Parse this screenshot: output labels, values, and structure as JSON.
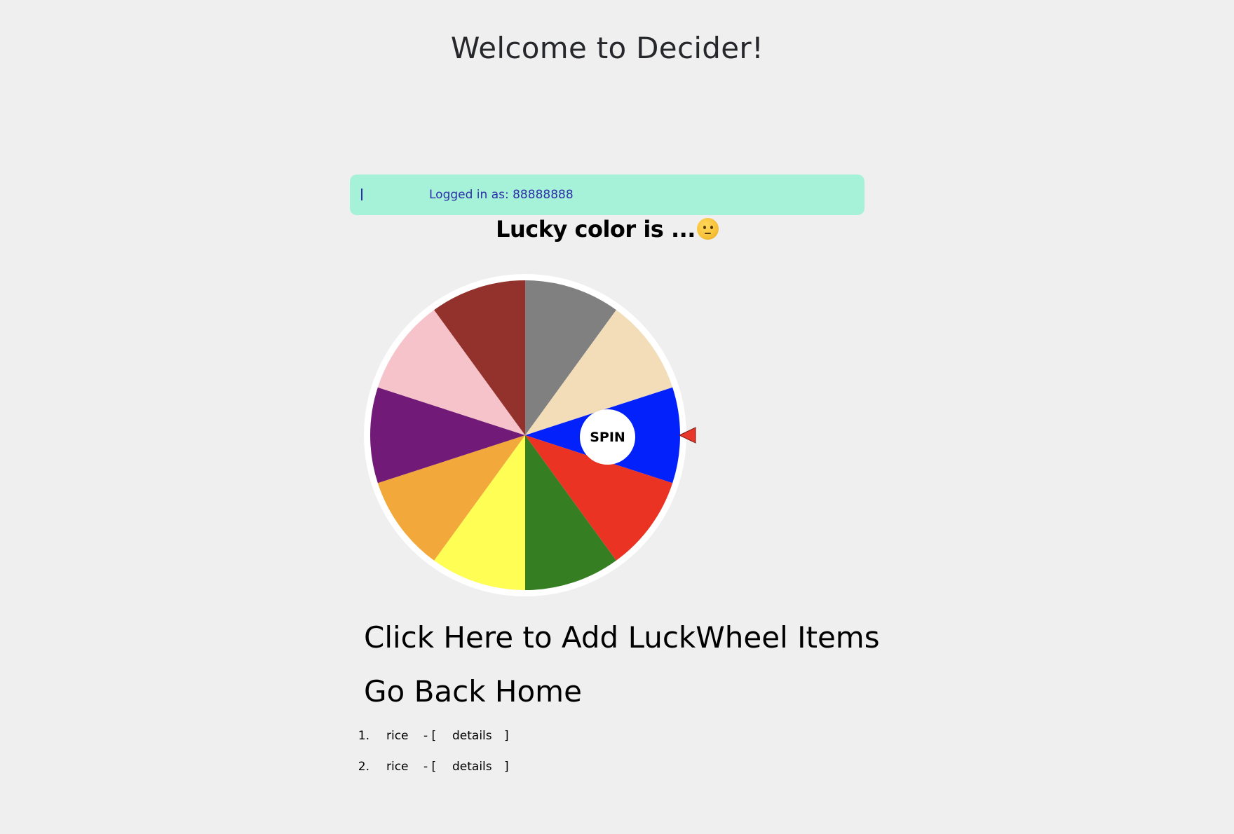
{
  "header": {
    "title": "Welcome to Decider!"
  },
  "session": {
    "logged_in_text": "Logged in as: 88888888"
  },
  "wheel": {
    "heading": "Lucky color is ...",
    "heading_emoji": "thinking-face-emoji",
    "spin_label": "SPIN",
    "pointer_color": "#e8372a",
    "segments": [
      {
        "color": "#808080"
      },
      {
        "color": "#f2ddb8"
      },
      {
        "color": "#0221fb"
      },
      {
        "color": "#ea3323"
      },
      {
        "color": "#367e22"
      },
      {
        "color": "#fefe54"
      },
      {
        "color": "#f2a83b"
      },
      {
        "color": "#721a77"
      },
      {
        "color": "#f6c3cb"
      },
      {
        "color": "#93322d"
      }
    ]
  },
  "links": {
    "add_items": "Click Here to Add LuckWheel Items",
    "go_home": "Go Back Home"
  },
  "items": [
    {
      "number": "1.",
      "name": "rice",
      "separator": "- [",
      "details_label": "details",
      "close": "]"
    },
    {
      "number": "2.",
      "name": "rice",
      "separator": "- [",
      "details_label": "details",
      "close": "]"
    }
  ]
}
